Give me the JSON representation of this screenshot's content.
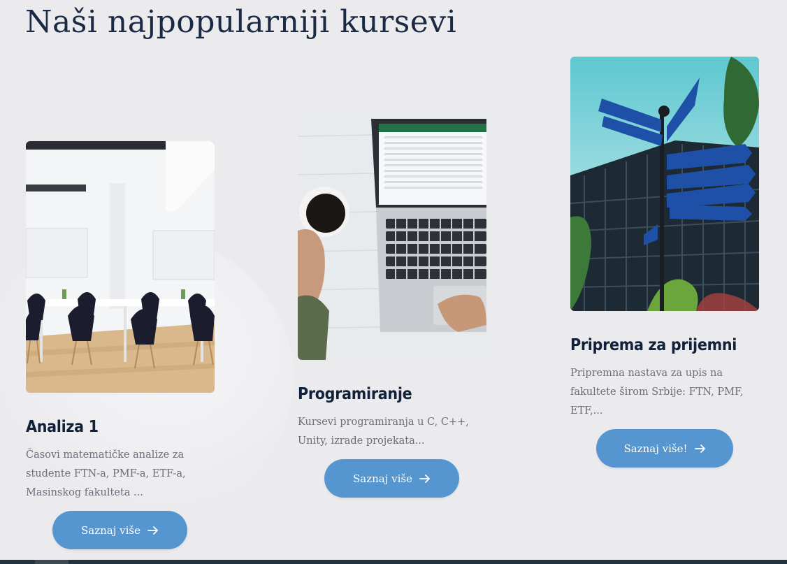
{
  "section": {
    "title": "Naši najpopularniji kursevi"
  },
  "courses": [
    {
      "title": "Analiza 1",
      "description": "Časovi matematičke analize za studente FTN-a, PMF-a, ETF-a, Masinskog fakulteta ...",
      "button_label": "Saznaj više",
      "image": "classroom-photo"
    },
    {
      "title": "Programiranje",
      "description": "Kursevi programiranja u C, C++, Unity, izrade projekata...",
      "button_label": "Saznaj više",
      "image": "laptop-coffee-photo"
    },
    {
      "title": "Priprema za prijemni",
      "description": "Pripremna nastava za upis na fakultete širom Srbije: FTN, PMF, ETF,...",
      "button_label": "Saznaj više!",
      "image": "faculty-signpost-photo"
    }
  ],
  "colors": {
    "background": "#ebebee",
    "button": "#5596d0",
    "heading": "#12213a",
    "text": "#6a6e78"
  }
}
